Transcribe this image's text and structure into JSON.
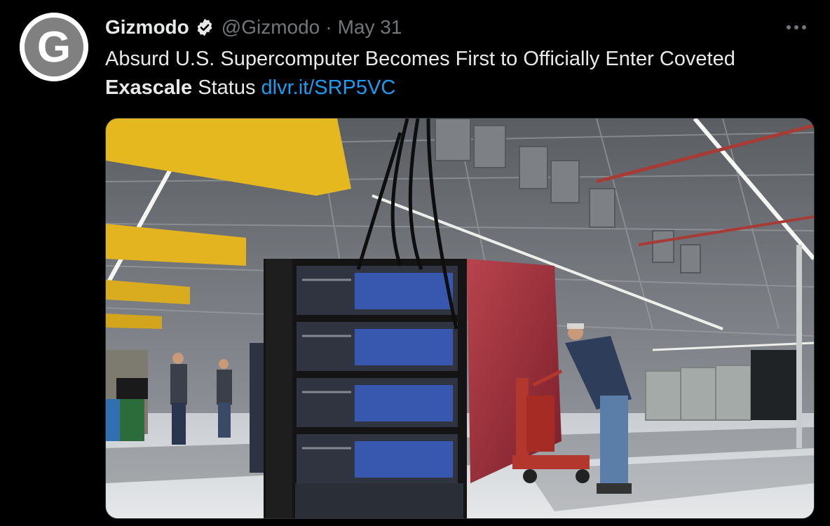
{
  "tweet": {
    "author": {
      "display_name": "Gizmodo",
      "avatar_letter": "G",
      "avatar_icon": "gizmodo-logo",
      "verified": true
    },
    "handle": "@Gizmodo",
    "separator": "·",
    "date": "May 31",
    "more_icon": "ellipsis-icon",
    "text": {
      "line1": "Absurd U.S. Supercomputer Becomes First to Officially Enter Coveted",
      "bold": "Exascale",
      "after_bold": " Status",
      "link": "dlvr.it/SRP5VC"
    },
    "media": {
      "type": "photo",
      "subject": "supercomputer-server-rack-photo"
    }
  },
  "colors": {
    "background": "#000000",
    "text_primary": "#e7e9ea",
    "text_secondary": "#71767b",
    "link": "#1d9bf0"
  }
}
